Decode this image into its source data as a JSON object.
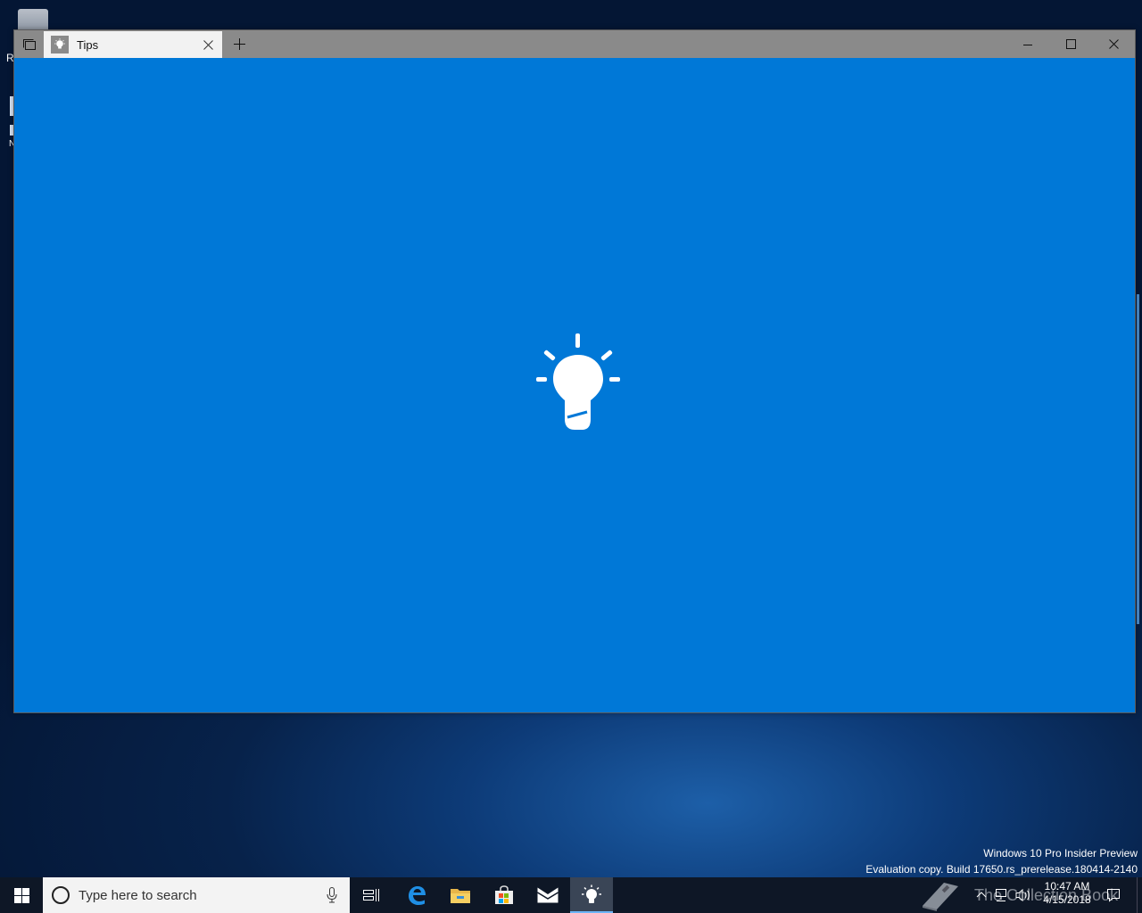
{
  "desktop": {
    "fragment_letter_1": "R",
    "fragment_letter_2": "N"
  },
  "window": {
    "tab_title": "Tips",
    "new_tab_label": "+",
    "accent_color": "#0078d7",
    "titlebar_color": "#8a8a8a"
  },
  "watermark": {
    "line1": "Windows 10 Pro Insider Preview",
    "line2": "Evaluation copy. Build 17650.rs_prerelease.180414-2140"
  },
  "taskbar": {
    "search_placeholder": "Type here to search",
    "overlay_watermark": "The Collection Book",
    "clock_time": "10:47 AM",
    "clock_date": "4/15/2018",
    "pinned": [
      "task-view-icon",
      "edge-icon",
      "file-explorer-icon",
      "store-icon",
      "mail-icon",
      "tips-icon"
    ]
  }
}
